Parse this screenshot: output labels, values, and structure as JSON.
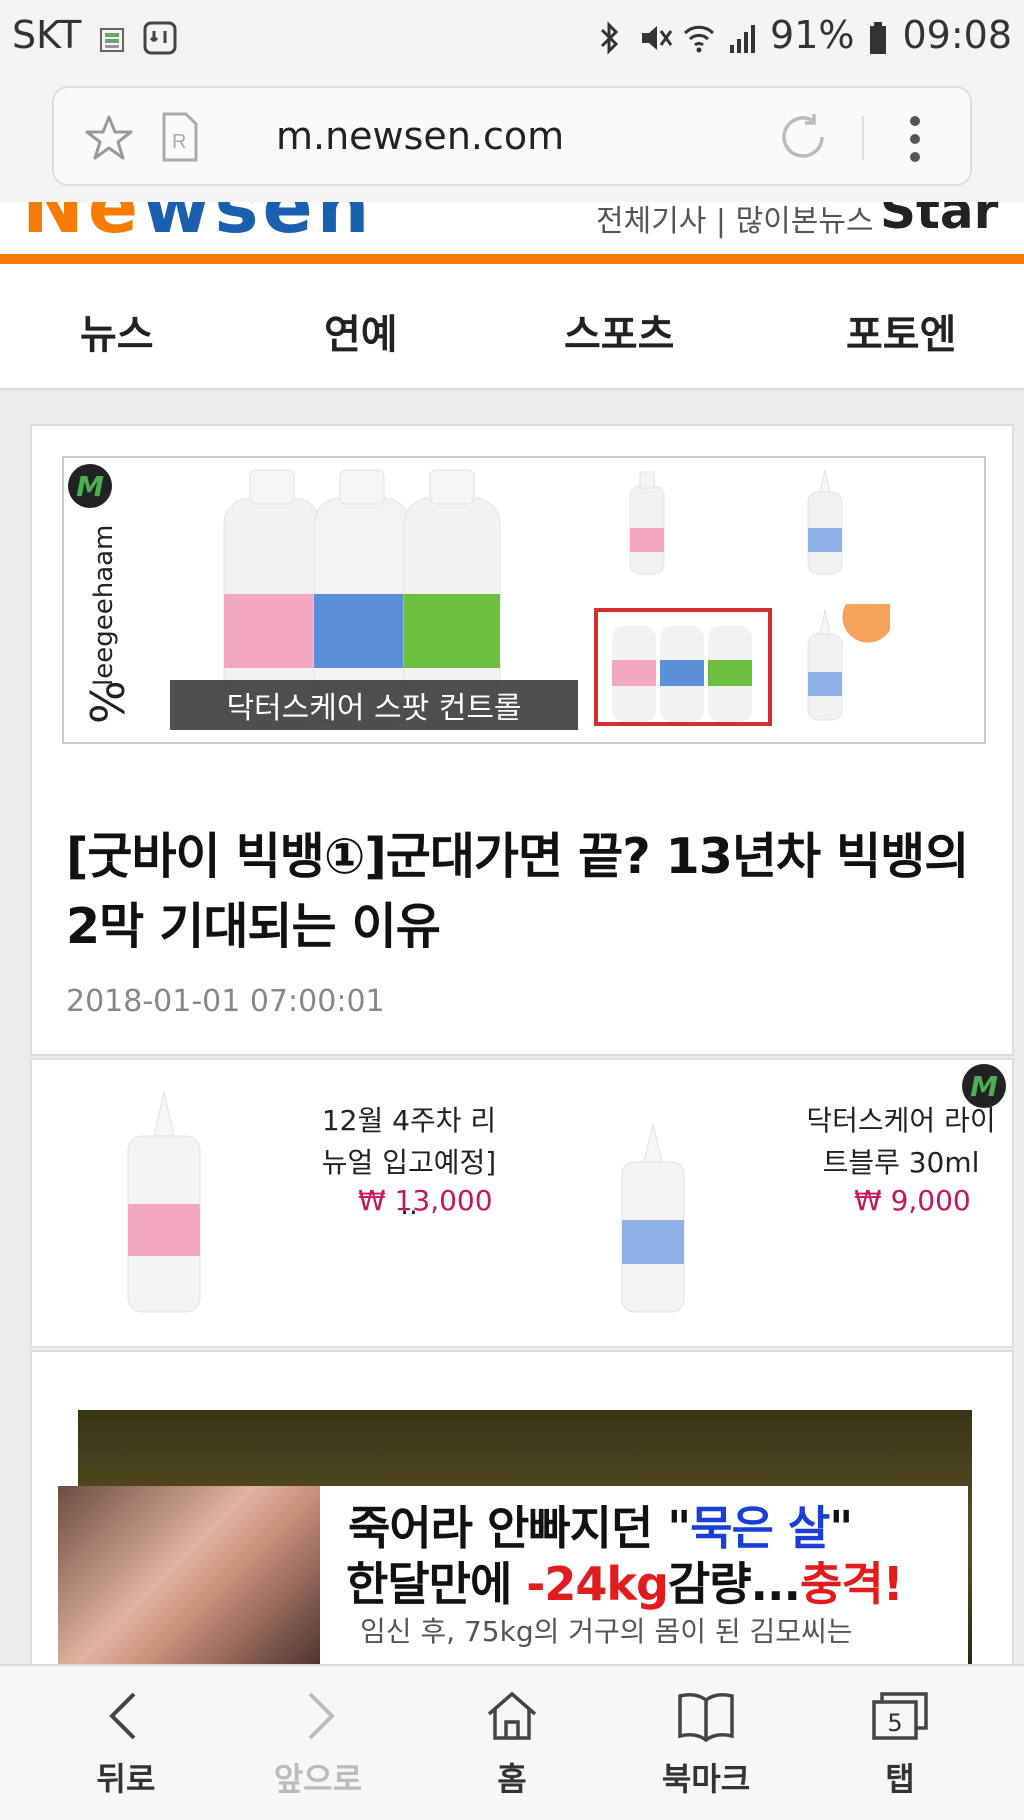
{
  "status_bar": {
    "carrier": "SKT",
    "battery": "91%",
    "time": "09:08",
    "icons": [
      "sim-icon",
      "download-icon",
      "bluetooth-icon",
      "mute-icon",
      "wifi-icon",
      "signal-icon",
      "battery-icon"
    ]
  },
  "browser": {
    "url": "m.newsen.com",
    "icons": [
      "bookmark-star-icon",
      "reader-icon",
      "reload-icon",
      "more-icon"
    ]
  },
  "site_header": {
    "links": "전체기사 | 많이본뉴스",
    "star_text": "Star"
  },
  "nav": {
    "items": [
      "뉴스",
      "연예",
      "스포츠",
      "포토엔"
    ]
  },
  "ad_banner": {
    "brand": "leegeehaam",
    "caption": "닥터스케어 스팟 컨트롤",
    "badge": "M"
  },
  "article": {
    "headline": "[굿바이 빅뱅①]군대가면 끝? 13년차 빅뱅의 2막 기대되는 이유",
    "date": "2018-01-01 07:00:01"
  },
  "products": [
    {
      "name": "12월 4주차 리뉴얼 입고예정] ..",
      "price": "₩ 13,000"
    },
    {
      "name": "닥터스케어 라이트블루 30ml",
      "price": "₩ 9,000"
    }
  ],
  "bottom_ad": {
    "line1_a": "죽어라 안빠지던 \"",
    "line1_b": "묵은 살",
    "line1_c": "\"",
    "line2_a": "한달만에 ",
    "line2_b": "-24kg",
    "line2_c": "감량...",
    "line2_d": "충격!",
    "line3": "임신 후, 75kg의 거구의 몸이 된 김모씨는"
  },
  "bottom_bar": {
    "back": "뒤로",
    "forward": "앞으로",
    "home": "홈",
    "bookmarks": "북마크",
    "tabs": "탭",
    "tab_count": "5"
  },
  "colors": {
    "accent_orange": "#f57c00",
    "price_red": "#c2185b",
    "ad_blue": "#1a3fd6",
    "ad_red": "#e21c1c"
  }
}
